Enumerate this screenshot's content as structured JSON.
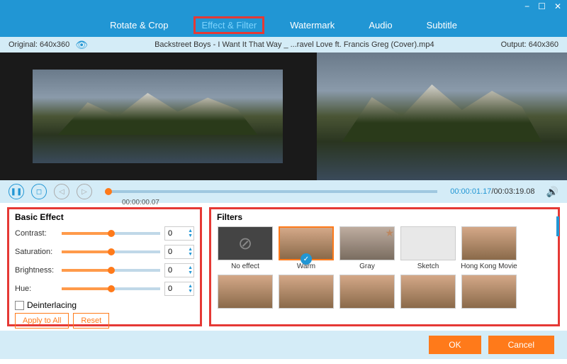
{
  "window": {
    "minimize": "−",
    "maximize": "☐",
    "close": "✕"
  },
  "tabs": {
    "rotate": "Rotate & Crop",
    "effect": "Effect & Filter",
    "watermark": "Watermark",
    "audio": "Audio",
    "subtitle": "Subtitle"
  },
  "infobar": {
    "original": "Original: 640x360",
    "filename": "Backstreet Boys - I Want It That Way _ ...ravel Love ft. Francis Greg (Cover).mp4",
    "output": "Output: 640x360"
  },
  "playback": {
    "scrub_time": "00:00:00.07",
    "current": "00:00:01.17",
    "total": "00:03:19.08"
  },
  "effects": {
    "title": "Basic Effect",
    "contrast_label": "Contrast:",
    "contrast_value": "0",
    "saturation_label": "Saturation:",
    "saturation_value": "0",
    "brightness_label": "Brightness:",
    "brightness_value": "0",
    "hue_label": "Hue:",
    "hue_value": "0",
    "deinterlacing_label": "Deinterlacing",
    "apply_all": "Apply to All",
    "reset": "Reset"
  },
  "filters": {
    "title": "Filters",
    "items": [
      {
        "name": "No effect",
        "selected": false,
        "noeffect": true
      },
      {
        "name": "Warm",
        "selected": true
      },
      {
        "name": "Gray",
        "selected": false,
        "starred": true
      },
      {
        "name": "Sketch",
        "selected": false
      },
      {
        "name": "Hong Kong Movie",
        "selected": false
      },
      {
        "name": "",
        "selected": false
      },
      {
        "name": "",
        "selected": false
      },
      {
        "name": "",
        "selected": false
      },
      {
        "name": "",
        "selected": false
      },
      {
        "name": "",
        "selected": false
      }
    ]
  },
  "footer": {
    "ok": "OK",
    "cancel": "Cancel"
  }
}
